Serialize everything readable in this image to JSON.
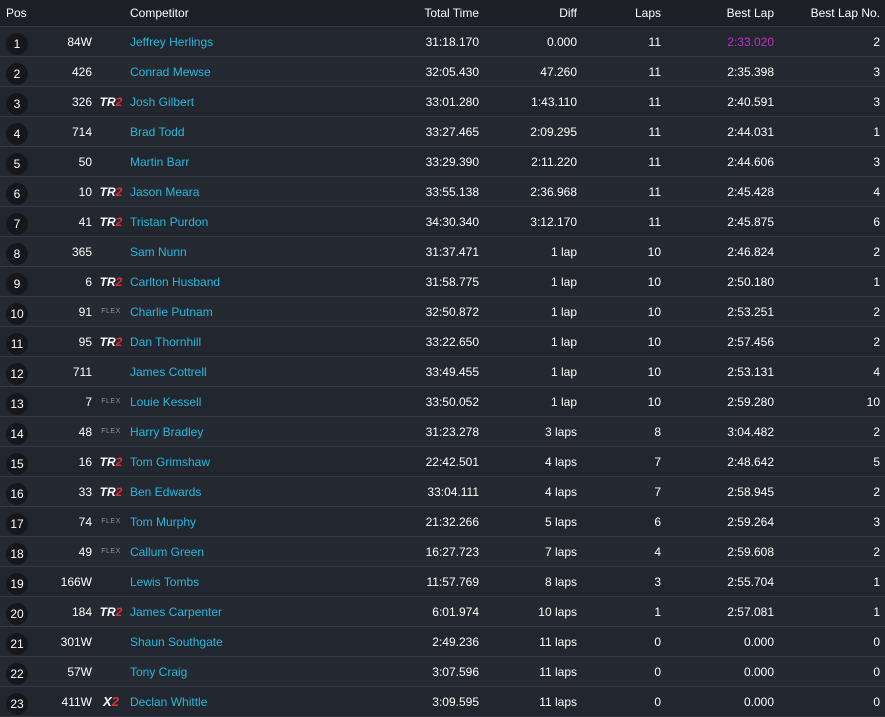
{
  "headers": {
    "pos": "Pos",
    "competitor": "Competitor",
    "total_time": "Total Time",
    "diff": "Diff",
    "laps": "Laps",
    "best_lap": "Best Lap",
    "best_lap_no": "Best Lap No."
  },
  "colors": {
    "name_link": "#27b8dd",
    "fastest_lap": "#c42fc4",
    "badge_red": "#e0303a",
    "background": "#22262e"
  },
  "rows": [
    {
      "pos": "1",
      "number": "84W",
      "badge": "",
      "name": "Jeffrey Herlings",
      "total": "31:18.170",
      "diff": "0.000",
      "laps": "11",
      "best": "2:33.020",
      "best_no": "2",
      "fastest": true
    },
    {
      "pos": "2",
      "number": "426",
      "badge": "",
      "name": "Conrad Mewse",
      "total": "32:05.430",
      "diff": "47.260",
      "laps": "11",
      "best": "2:35.398",
      "best_no": "3"
    },
    {
      "pos": "3",
      "number": "326",
      "badge": "TR2",
      "name": "Josh Gilbert",
      "total": "33:01.280",
      "diff": "1:43.110",
      "laps": "11",
      "best": "2:40.591",
      "best_no": "3"
    },
    {
      "pos": "4",
      "number": "714",
      "badge": "",
      "name": "Brad Todd",
      "total": "33:27.465",
      "diff": "2:09.295",
      "laps": "11",
      "best": "2:44.031",
      "best_no": "1"
    },
    {
      "pos": "5",
      "number": "50",
      "badge": "",
      "name": "Martin Barr",
      "total": "33:29.390",
      "diff": "2:11.220",
      "laps": "11",
      "best": "2:44.606",
      "best_no": "3"
    },
    {
      "pos": "6",
      "number": "10",
      "badge": "TR2",
      "name": "Jason Meara",
      "total": "33:55.138",
      "diff": "2:36.968",
      "laps": "11",
      "best": "2:45.428",
      "best_no": "4"
    },
    {
      "pos": "7",
      "number": "41",
      "badge": "TR2",
      "name": "Tristan Purdon",
      "total": "34:30.340",
      "diff": "3:12.170",
      "laps": "11",
      "best": "2:45.875",
      "best_no": "6"
    },
    {
      "pos": "8",
      "number": "365",
      "badge": "",
      "name": "Sam Nunn",
      "total": "31:37.471",
      "diff": "1 lap",
      "laps": "10",
      "best": "2:46.824",
      "best_no": "2"
    },
    {
      "pos": "9",
      "number": "6",
      "badge": "TR2",
      "name": "Carlton Husband",
      "total": "31:58.775",
      "diff": "1 lap",
      "laps": "10",
      "best": "2:50.180",
      "best_no": "1"
    },
    {
      "pos": "10",
      "number": "91",
      "badge": "FLEX",
      "name": "Charlie Putnam",
      "total": "32:50.872",
      "diff": "1 lap",
      "laps": "10",
      "best": "2:53.251",
      "best_no": "2"
    },
    {
      "pos": "11",
      "number": "95",
      "badge": "TR2",
      "name": "Dan Thornhill",
      "total": "33:22.650",
      "diff": "1 lap",
      "laps": "10",
      "best": "2:57.456",
      "best_no": "2"
    },
    {
      "pos": "12",
      "number": "711",
      "badge": "",
      "name": "James Cottrell",
      "total": "33:49.455",
      "diff": "1 lap",
      "laps": "10",
      "best": "2:53.131",
      "best_no": "4"
    },
    {
      "pos": "13",
      "number": "7",
      "badge": "FLEX",
      "name": "Louie Kessell",
      "total": "33:50.052",
      "diff": "1 lap",
      "laps": "10",
      "best": "2:59.280",
      "best_no": "10"
    },
    {
      "pos": "14",
      "number": "48",
      "badge": "FLEX",
      "name": "Harry Bradley",
      "total": "31:23.278",
      "diff": "3 laps",
      "laps": "8",
      "best": "3:04.482",
      "best_no": "2"
    },
    {
      "pos": "15",
      "number": "16",
      "badge": "TR2",
      "name": "Tom Grimshaw",
      "total": "22:42.501",
      "diff": "4 laps",
      "laps": "7",
      "best": "2:48.642",
      "best_no": "5"
    },
    {
      "pos": "16",
      "number": "33",
      "badge": "TR2",
      "name": "Ben Edwards",
      "total": "33:04.111",
      "diff": "4 laps",
      "laps": "7",
      "best": "2:58.945",
      "best_no": "2"
    },
    {
      "pos": "17",
      "number": "74",
      "badge": "FLEX",
      "name": "Tom Murphy",
      "total": "21:32.266",
      "diff": "5 laps",
      "laps": "6",
      "best": "2:59.264",
      "best_no": "3"
    },
    {
      "pos": "18",
      "number": "49",
      "badge": "FLEX",
      "name": "Callum Green",
      "total": "16:27.723",
      "diff": "7 laps",
      "laps": "4",
      "best": "2:59.608",
      "best_no": "2"
    },
    {
      "pos": "19",
      "number": "166W",
      "badge": "",
      "name": "Lewis Tombs",
      "total": "11:57.769",
      "diff": "8 laps",
      "laps": "3",
      "best": "2:55.704",
      "best_no": "1"
    },
    {
      "pos": "20",
      "number": "184",
      "badge": "TR2",
      "name": "James Carpenter",
      "total": "6:01.974",
      "diff": "10 laps",
      "laps": "1",
      "best": "2:57.081",
      "best_no": "1"
    },
    {
      "pos": "21",
      "number": "301W",
      "badge": "",
      "name": "Shaun Southgate",
      "total": "2:49.236",
      "diff": "11 laps",
      "laps": "0",
      "best": "0.000",
      "best_no": "0"
    },
    {
      "pos": "22",
      "number": "57W",
      "badge": "",
      "name": "Tony Craig",
      "total": "3:07.596",
      "diff": "11 laps",
      "laps": "0",
      "best": "0.000",
      "best_no": "0"
    },
    {
      "pos": "23",
      "number": "411W",
      "badge": "X2",
      "name": "Declan Whittle",
      "total": "3:09.595",
      "diff": "11 laps",
      "laps": "0",
      "best": "0.000",
      "best_no": "0"
    }
  ]
}
